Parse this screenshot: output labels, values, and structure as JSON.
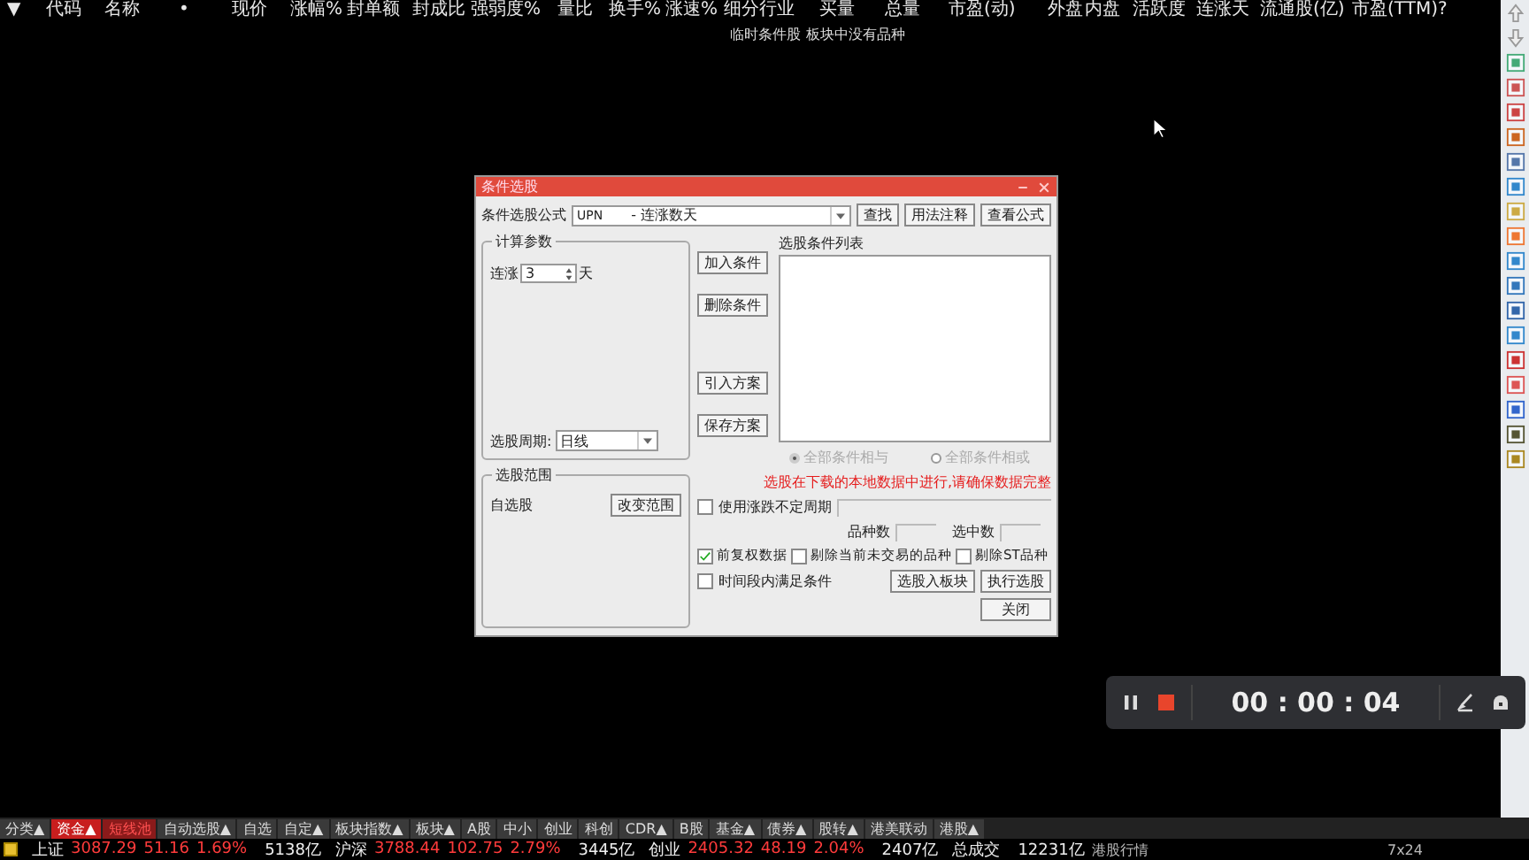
{
  "columns": [
    "▼",
    "代码",
    "名称",
    "•",
    "现价",
    "涨幅%",
    "封单额",
    "封成比",
    "强弱度%",
    "量比",
    "换手%",
    "涨速%",
    "细分行业",
    "买量",
    "总量",
    "市盈(动)",
    "外盘",
    "内盘",
    "活跃度",
    "连涨天",
    "流通股(亿)",
    "市盈(TTM)",
    "?"
  ],
  "notice": "临时条件股 板块中没有品种",
  "dialog": {
    "title": "条件选股",
    "formula_label": "条件选股公式",
    "formula_code": "UPN",
    "formula_name": "- 连涨数天",
    "formula_buttons": [
      "查找",
      "用法注释",
      "查看公式"
    ],
    "params_group": "计算参数",
    "param_label": "连涨",
    "param_value": "3",
    "param_unit": "天",
    "period_label": "选股周期:",
    "period_value": "日线",
    "action_buttons": [
      "加入条件",
      "删除条件",
      "引入方案",
      "保存方案"
    ],
    "list_label": "选股条件列表",
    "logic": [
      {
        "label": "全部条件相与",
        "selected": true
      },
      {
        "label": "全部条件相或",
        "selected": false
      }
    ],
    "logic_disabled": true,
    "warning": "选股在下载的本地数据中进行,请确保数据完整",
    "range_group": "选股范围",
    "range_value": "自选股",
    "range_button": "改变范围",
    "variable_period": {
      "label": "使用涨跌不定周期",
      "checked": false
    },
    "count_labels": [
      "品种数",
      "选中数"
    ],
    "options": [
      {
        "label": "前复权数据",
        "checked": true
      },
      {
        "label": "剔除当前未交易的品种",
        "checked": false
      },
      {
        "label": "剔除ST品种",
        "checked": false
      }
    ],
    "time_option": {
      "label": "时间段内满足条件",
      "checked": false
    },
    "bottom_buttons": [
      "选股入板块",
      "执行选股"
    ],
    "close_button": "关闭"
  },
  "recorder": {
    "time": "00 : 00 : 04"
  },
  "tabs": [
    {
      "label": "分类▲",
      "kind": "plain"
    },
    {
      "label": "资金▲",
      "kind": "active"
    },
    {
      "label": "短线池",
      "kind": "alert"
    },
    {
      "label": "自动选股▲",
      "kind": "plain"
    },
    {
      "label": "自选",
      "kind": "plain"
    },
    {
      "label": "自定▲",
      "kind": "plain"
    },
    {
      "label": "板块指数▲",
      "kind": "plain"
    },
    {
      "label": "板块▲",
      "kind": "plain"
    },
    {
      "label": "A股",
      "kind": "plain"
    },
    {
      "label": "中小",
      "kind": "plain"
    },
    {
      "label": "创业",
      "kind": "plain"
    },
    {
      "label": "科创",
      "kind": "plain"
    },
    {
      "label": "CDR▲",
      "kind": "plain"
    },
    {
      "label": "B股",
      "kind": "plain"
    },
    {
      "label": "基金▲",
      "kind": "plain"
    },
    {
      "label": "债券▲",
      "kind": "plain"
    },
    {
      "label": "股转▲",
      "kind": "plain"
    },
    {
      "label": "港美联动",
      "kind": "plain"
    },
    {
      "label": "港股▲",
      "kind": "plain"
    }
  ],
  "indices": [
    {
      "name": "上证",
      "value": "3087.29",
      "change": "51.16",
      "pct": "1.69%",
      "amount": "5138亿",
      "up": true
    },
    {
      "name": "沪深",
      "value": "3788.44",
      "change": "102.75",
      "pct": "2.79%",
      "amount": "3445亿",
      "up": true
    },
    {
      "name": "创业",
      "value": "2405.32",
      "change": "48.19",
      "pct": "2.04%",
      "amount": "2407亿",
      "up": true
    }
  ],
  "turnover": {
    "label": "总成交",
    "value": "12231亿"
  },
  "ticker": "港股行情",
  "clock_label": "7x24"
}
